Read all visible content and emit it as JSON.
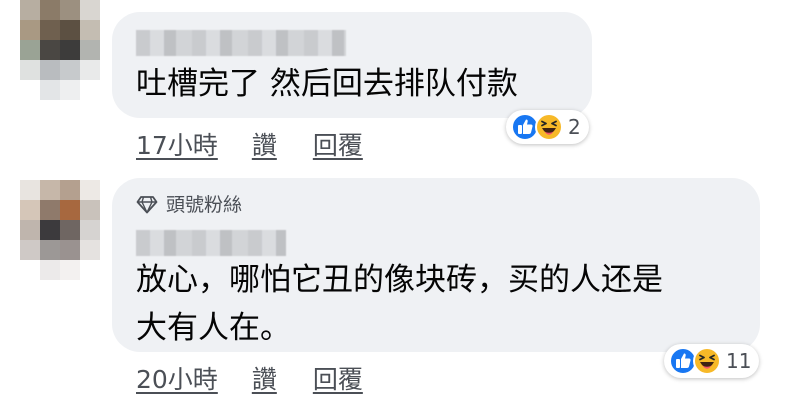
{
  "comments": [
    {
      "text": "吐槽完了 然后回去排队付款",
      "time": "17小時",
      "like_label": "讚",
      "reply_label": "回覆",
      "reaction_count": "2",
      "reactions": [
        "like-icon",
        "haha-icon"
      ]
    },
    {
      "badge": "頭號粉絲",
      "text": "放心，哪怕它丑的像块砖，买的人还是\n大有人在。",
      "time": "20小時",
      "like_label": "讚",
      "reply_label": "回覆",
      "reaction_count": "11",
      "reactions": [
        "like-icon",
        "haha-icon"
      ]
    }
  ],
  "colors": {
    "bubble": "#eff1f4",
    "like_blue": "#1877f2",
    "haha_yellow": "#f7b928",
    "meta_text": "#4b4f56"
  }
}
